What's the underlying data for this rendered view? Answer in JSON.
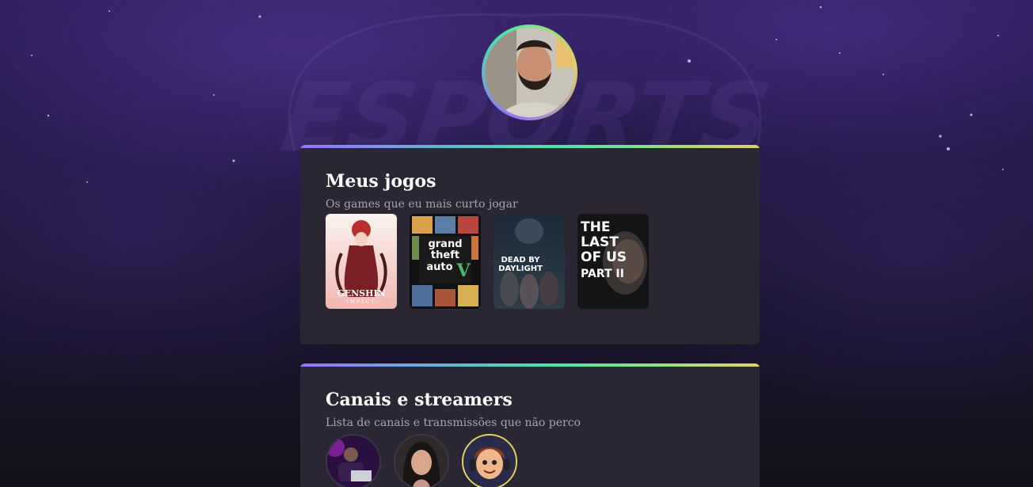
{
  "profile": {
    "avatar_icon": "profile-photo-man-beard"
  },
  "background": {
    "watermark_text": "ESPORTS"
  },
  "sections": [
    {
      "title": "Meus jogos",
      "subtitle": "Os games que eu mais curto jogar",
      "games": [
        {
          "name": "Genshin Impact",
          "cover_lines": [
            "GENSHIN",
            "IMPACT"
          ]
        },
        {
          "name": "Grand Theft Auto V",
          "cover_lines": [
            "grand",
            "theft",
            "auto",
            "V"
          ]
        },
        {
          "name": "Dead by Daylight",
          "cover_lines": [
            "DEAD BY",
            "DAYLIGHT"
          ]
        },
        {
          "name": "The Last of Us Part II",
          "cover_lines": [
            "THE",
            "LAST",
            "OF US",
            "PART II"
          ]
        }
      ]
    },
    {
      "title": "Canais e streamers",
      "subtitle": "Lista de canais e transmissões que não perco",
      "streamers": [
        {
          "avatar_icon": "streamer-dj-avatar"
        },
        {
          "avatar_icon": "streamer-woman-avatar"
        },
        {
          "avatar_icon": "streamer-cartoon-avatar"
        }
      ]
    }
  ],
  "colors": {
    "accent_purple": "#9572fc",
    "accent_green": "#43e7ad",
    "accent_yellow": "#e2d45c",
    "card_bg": "#2a2634"
  }
}
